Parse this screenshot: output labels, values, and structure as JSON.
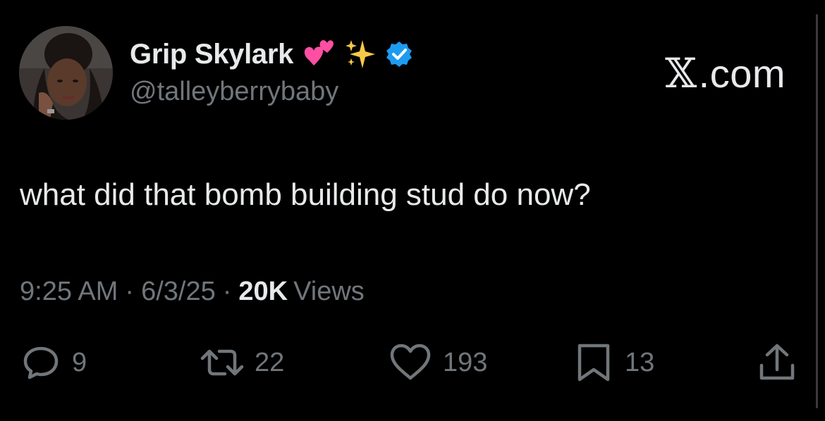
{
  "author": {
    "display_name": "Grip Skylark",
    "name_emojis": [
      "two-hearts-icon",
      "sparkles-icon"
    ],
    "verified": true,
    "handle": "@talleyberrybaby",
    "avatar": "avatar"
  },
  "brand": {
    "logo": "x-logo-icon",
    "text": ".com"
  },
  "tweet": {
    "text": "what did that bomb building stud do now?"
  },
  "meta": {
    "time": "9:25 AM",
    "date": "6/3/25",
    "views_count": "20K",
    "views_label": "Views"
  },
  "actions": {
    "replies": "9",
    "reposts": "22",
    "likes": "193",
    "bookmarks": "13"
  },
  "colors": {
    "background": "#000000",
    "primary_text": "#e7e9ea",
    "secondary_text": "#71767b",
    "verified_badge": "#1d9bf0"
  }
}
